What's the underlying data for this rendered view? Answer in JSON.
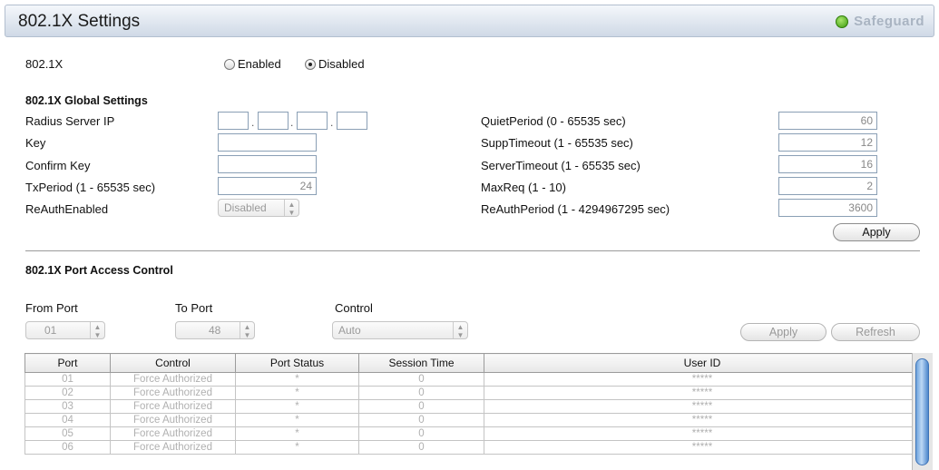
{
  "title": "802.1X Settings",
  "brand": "Safeguard",
  "dot8021x": {
    "label": "802.1X",
    "enabled_label": "Enabled",
    "disabled_label": "Disabled",
    "selected": "Disabled"
  },
  "global": {
    "heading": "802.1X Global Settings",
    "radius_label": "Radius Server IP",
    "radius_octets": [
      "",
      "",
      "",
      ""
    ],
    "key_label": "Key",
    "key_value": "",
    "confirm_label": "Confirm Key",
    "confirm_value": "",
    "txperiod_label": "TxPeriod (1 - 65535 sec)",
    "txperiod_value": "24",
    "reauth_label": "ReAuthEnabled",
    "reauth_value": "Disabled",
    "quiet_label": "QuietPeriod (0 - 65535 sec)",
    "quiet_value": "60",
    "supp_label": "SuppTimeout (1 - 65535 sec)",
    "supp_value": "12",
    "server_label": "ServerTimeout (1 - 65535 sec)",
    "server_value": "16",
    "maxreq_label": "MaxReq (1 - 10)",
    "maxreq_value": "2",
    "reauthperiod_label": "ReAuthPeriod (1 - 4294967295 sec)",
    "reauthperiod_value": "3600",
    "apply_label": "Apply"
  },
  "port_access": {
    "heading": "802.1X Port Access Control",
    "from_label": "From Port",
    "from_value": "01",
    "to_label": "To Port",
    "to_value": "48",
    "control_label": "Control",
    "control_value": "Auto",
    "apply_label": "Apply",
    "refresh_label": "Refresh"
  },
  "table": {
    "headers": [
      "Port",
      "Control",
      "Port Status",
      "Session Time",
      "User ID"
    ],
    "rows": [
      [
        "01",
        "Force Authorized",
        "*",
        "0",
        "*****"
      ],
      [
        "02",
        "Force Authorized",
        "*",
        "0",
        "*****"
      ],
      [
        "03",
        "Force Authorized",
        "*",
        "0",
        "*****"
      ],
      [
        "04",
        "Force Authorized",
        "*",
        "0",
        "*****"
      ],
      [
        "05",
        "Force Authorized",
        "*",
        "0",
        "*****"
      ],
      [
        "06",
        "Force Authorized",
        "*",
        "0",
        "*****"
      ]
    ]
  }
}
